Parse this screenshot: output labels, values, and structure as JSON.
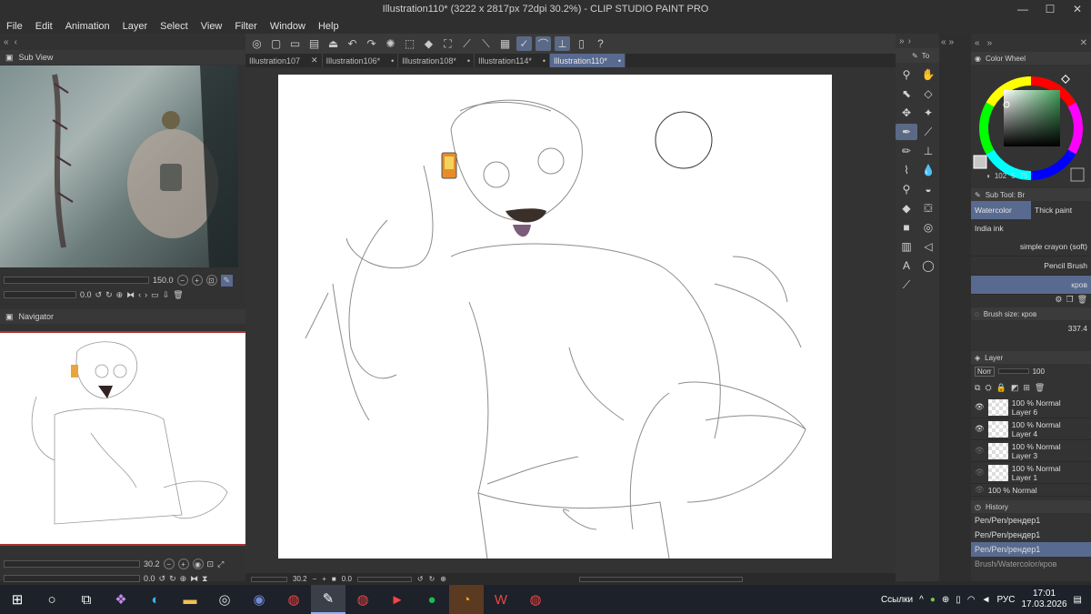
{
  "window": {
    "title": "Illustration110* (3222 x 2817px 72dpi 30.2%) - CLIP STUDIO PAINT PRO",
    "minimize": "—",
    "maximize": "☐",
    "close": "✕"
  },
  "menu": [
    "File",
    "Edit",
    "Animation",
    "Layer",
    "Select",
    "View",
    "Filter",
    "Window",
    "Help"
  ],
  "tabs": [
    {
      "label": "Illustration107",
      "close": "✕"
    },
    {
      "label": "Illustration106*",
      "close": "•"
    },
    {
      "label": "Illustration108*",
      "close": "•"
    },
    {
      "label": "Illustration114*",
      "close": "•"
    },
    {
      "label": "Illustration110*",
      "close": "•"
    }
  ],
  "subview": {
    "title": "Sub View",
    "zoom": "150.0",
    "rotation": "0.0"
  },
  "navigator": {
    "title": "Navigator",
    "zoom": "30.2",
    "rotation": "0.0"
  },
  "canvas_status": {
    "zoom": "30.2",
    "rotation": "0.0"
  },
  "tool_panel": {
    "title": "To"
  },
  "color_wheel": {
    "title": "Color Wheel",
    "h": "102",
    "s": "5",
    "v": "75",
    "accent": "#41a05a"
  },
  "sub_tool": {
    "title": "Sub Tool: Br",
    "tabs": [
      "Watercolor",
      "Thick paint",
      "India ink"
    ],
    "brushes": [
      "simple crayon (soft)",
      "Pencil Brush",
      "кров"
    ]
  },
  "brush_size": {
    "title": "Brush size: кров",
    "value": "337.4"
  },
  "layer_panel": {
    "title": "Layer",
    "blend": "Norr",
    "opacity": "100",
    "layers": [
      {
        "info": "100 % Normal",
        "name": "Layer 6"
      },
      {
        "info": "100 % Normal",
        "name": "Layer 4"
      },
      {
        "info": "100 % Normal",
        "name": "Layer 3"
      },
      {
        "info": "100 % Normal",
        "name": "Layer 1"
      },
      {
        "info": "100 % Normal",
        "name": ""
      }
    ]
  },
  "history": {
    "title": "History",
    "items": [
      "Pen/Pen/рендер1",
      "Pen/Pen/рендер1",
      "Pen/Pen/рендер1",
      "Brush/Watercolor/кров"
    ]
  },
  "taskbar": {
    "links_label": "Ссылки",
    "lang": "РУС",
    "time": "17:01",
    "date": "17.03.2026"
  }
}
